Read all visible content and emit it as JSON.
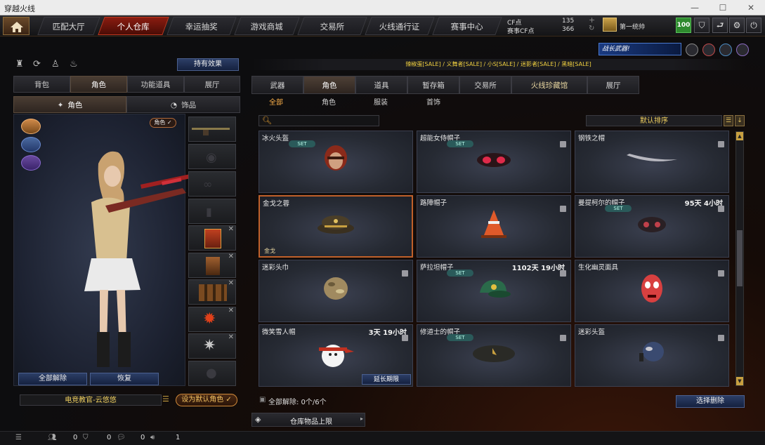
{
  "window": {
    "title": "穿越火线",
    "min": "—",
    "max": "☐",
    "close": "✕"
  },
  "nav": {
    "tabs": [
      {
        "label": "匹配大厅"
      },
      {
        "label": "个人仓库"
      },
      {
        "label": "幸运抽奖"
      },
      {
        "label": "游戏商城"
      },
      {
        "label": "交易所"
      },
      {
        "label": "火线通行证"
      },
      {
        "label": "赛事中心"
      }
    ],
    "cf_label": "CF点",
    "cf_value": "135",
    "match_cf_label": "赛事CF点",
    "match_cf_value": "366",
    "rank_name": "第一统帅",
    "level_badge": "100",
    "icon_names": [
      "home-icon",
      "shield-icon",
      "exit-icon",
      "gear-icon",
      "power-icon"
    ]
  },
  "left": {
    "top_icons": [
      "stats-icon",
      "refresh-icon",
      "person-icon",
      "bag-icon"
    ],
    "effects_button": "持有效果",
    "tabs": [
      {
        "label": "背包"
      },
      {
        "label": "角色"
      },
      {
        "label": "功能道具"
      },
      {
        "label": "展厅"
      }
    ],
    "subtabs": [
      {
        "label": "角色"
      },
      {
        "label": "饰品"
      }
    ],
    "role_badge": "角色 ✓",
    "unequip_all": "全部解除",
    "restore": "恢复",
    "character_name": "电竞教官-云悠悠",
    "set_default": "设为默认角色 ✓"
  },
  "right": {
    "promo": "战长武器!",
    "ticker": "辣椒蛋[SALE]  /  义舞者[SALE]  /  小S[SALE]  /  迷影者[SALE]  /  黑暗[SALE]",
    "tabs": [
      {
        "label": "武器"
      },
      {
        "label": "角色"
      },
      {
        "label": "道具"
      },
      {
        "label": "暂存箱"
      },
      {
        "label": "交易所"
      },
      {
        "label": "火线珍藏馆"
      },
      {
        "label": "展厅"
      }
    ],
    "subtabs": [
      {
        "label": "全部"
      },
      {
        "label": "角色"
      },
      {
        "label": "服装"
      },
      {
        "label": "首饰"
      }
    ],
    "search_placeholder": "",
    "sort_label": "默认排序",
    "items": [
      {
        "name": "冰火头盔",
        "set": "SET",
        "time": "",
        "tag": "",
        "icon": "helmet-red-icon"
      },
      {
        "name": "超能女侍帽子",
        "set": "SET",
        "time": "",
        "tag": "",
        "icon": "hat-pink-icon"
      },
      {
        "name": "钢铁之帽",
        "set": "",
        "time": "",
        "tag": "",
        "icon": "scythe-hat-icon"
      },
      {
        "name": "金戈之蓉",
        "set": "",
        "time": "",
        "tag": "金戈",
        "icon": "officer-cap-icon"
      },
      {
        "name": "路障帽子",
        "set": "",
        "time": "",
        "tag": "",
        "icon": "traffic-cone-icon"
      },
      {
        "name": "曼提柯尔的帽子",
        "set": "SET",
        "time": "95天 4小时",
        "tag": "",
        "icon": "beast-hat-icon"
      },
      {
        "name": "迷彩头巾",
        "set": "",
        "time": "",
        "tag": "",
        "icon": "camo-helmet-icon"
      },
      {
        "name": "萨拉坦帽子",
        "set": "SET",
        "time": "1102天 19小时",
        "tag": "",
        "icon": "green-cap-icon"
      },
      {
        "name": "生化幽灵面具",
        "set": "",
        "time": "",
        "tag": "",
        "icon": "zombie-mask-icon"
      },
      {
        "name": "微笑雪人帽",
        "set": "",
        "time": "3天 19小时",
        "tag": "",
        "icon": "snowman-hat-icon",
        "extend": "延长期限"
      },
      {
        "name": "修道士的帽子",
        "set": "SET",
        "time": "",
        "tag": "",
        "icon": "beret-icon"
      },
      {
        "name": "迷彩头盔",
        "set": "",
        "time": "",
        "tag": "",
        "icon": "camo-headset-icon"
      }
    ],
    "unequip_summary": "全部解除: 0个/6个",
    "select_delete": "选择删除",
    "storage_limit": "仓库物品上限"
  },
  "footer": {
    "friends": "0",
    "clan": "0",
    "chat": "0",
    "volume": "1"
  },
  "colors": {
    "accent": "#c0381e",
    "gold": "#ffb24a",
    "set_badge": "#2a5a5a",
    "button_blue": "#2c3e66"
  }
}
